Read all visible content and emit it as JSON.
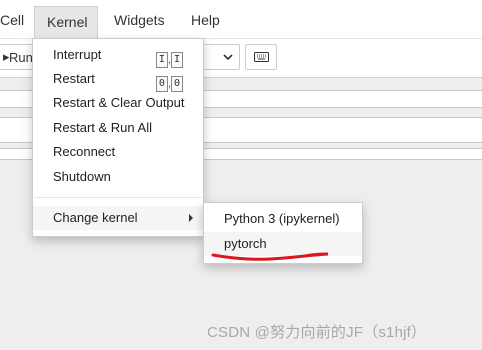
{
  "menubar": {
    "items": [
      "Cell",
      "Kernel",
      "Widgets",
      "Help"
    ]
  },
  "toolbar": {
    "run_label": "Run",
    "keyboard_icon": "keyboard-icon"
  },
  "kernel_menu": {
    "items": [
      {
        "label": "Interrupt",
        "shortcut": [
          "I",
          "I"
        ]
      },
      {
        "label": "Restart",
        "shortcut": [
          "0",
          "0"
        ]
      },
      {
        "label": "Restart & Clear Output"
      },
      {
        "label": "Restart & Run All"
      },
      {
        "label": "Reconnect"
      },
      {
        "label": "Shutdown"
      },
      {
        "label": "Change kernel"
      }
    ]
  },
  "change_kernel_submenu": {
    "items": [
      "Python 3 (ipykernel)",
      "pytorch"
    ],
    "selected": "pytorch",
    "annotation_color": "#e0161e"
  },
  "watermark": "CSDN @努力向前的JF（s1hjf）"
}
